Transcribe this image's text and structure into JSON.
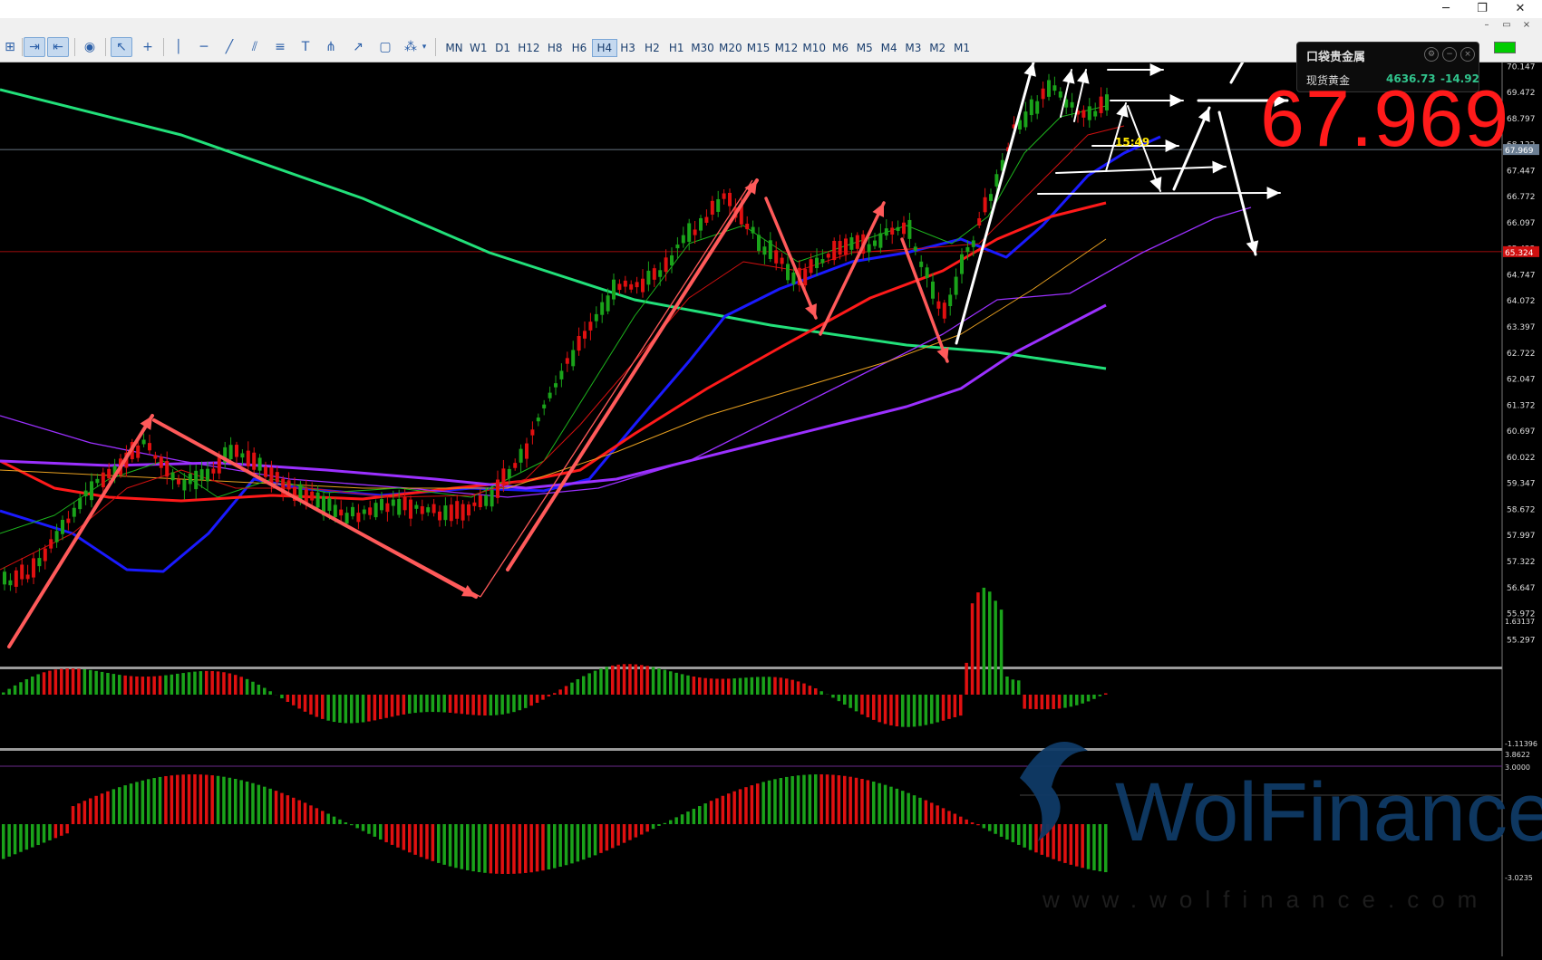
{
  "timeframes": [
    "MN",
    "W1",
    "D1",
    "H12",
    "H8",
    "H6",
    "H4",
    "H3",
    "H2",
    "H1",
    "M30",
    "M20",
    "M15",
    "M12",
    "M10",
    "M6",
    "M5",
    "M4",
    "M3",
    "M2",
    "M1"
  ],
  "active_timeframe": "H4",
  "window": {
    "minimize": "─",
    "restore": "❐",
    "close": "✕"
  },
  "sub_window": {
    "minimize": "–",
    "restore": "▭",
    "close": "×"
  },
  "quote": {
    "title": "口袋贵金属",
    "name": "现货黄金",
    "price": "4636.73",
    "change": "-14.92"
  },
  "big_price": "67.969",
  "countdown": "15:49",
  "price_axis": [
    "70.147",
    "69.472",
    "68.797",
    "68.122",
    "67.447",
    "66.772",
    "66.097",
    "65.422",
    "64.747",
    "64.072",
    "63.397",
    "62.722",
    "62.047",
    "61.372",
    "60.697",
    "60.022",
    "59.347",
    "58.672",
    "57.997",
    "57.322",
    "56.647",
    "55.972",
    "55.297"
  ],
  "current_price_label": "67.969",
  "red_line_label": "65.324",
  "macd_axis": {
    "top": "1.63137",
    "bottom": "-1.11396"
  },
  "osc_axis": {
    "top": "3.8622",
    "mid": "3.0000",
    "bottom": "-3.0235"
  },
  "watermark": {
    "brand": "WolFinance",
    "url": "www.wolfinance.com"
  },
  "colors": {
    "up": "#1aa31a",
    "down": "#e01010",
    "ma_green": "#22e07a",
    "ma_blue": "#1a1aff",
    "ma_red": "#ff1a1a",
    "ma_purple": "#9b30ff",
    "ma_orange": "#e8a020",
    "arrow_red": "#ff5a5a",
    "arrow_white": "#ffffff"
  }
}
